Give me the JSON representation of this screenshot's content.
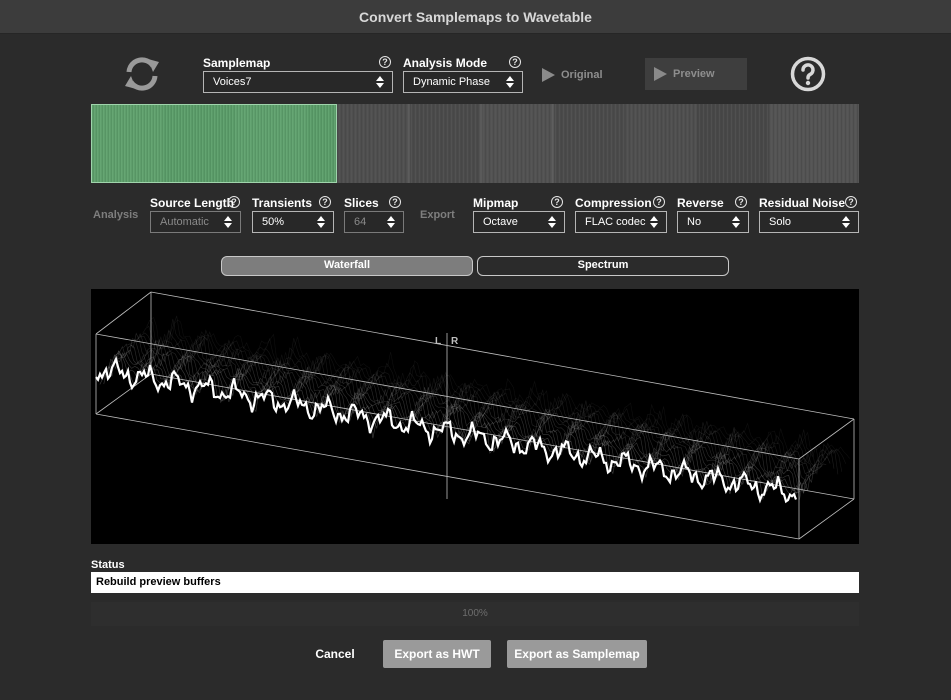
{
  "window": {
    "title": "Convert Samplemaps to Wavetable"
  },
  "toolbar": {
    "refresh_icon": "refresh-icon",
    "samplemap": {
      "label": "Samplemap",
      "value": "Voices7"
    },
    "analysis_mode": {
      "label": "Analysis Mode",
      "value": "Dynamic Phase"
    },
    "original_label": "Original",
    "preview_label": "Preview",
    "help_icon": "help-icon"
  },
  "parameters": {
    "analysis_label": "Analysis",
    "export_label": "Export",
    "source_length": {
      "label": "Source Length",
      "value": "Automatic"
    },
    "transients": {
      "label": "Transients",
      "value": "50%"
    },
    "slices": {
      "label": "Slices",
      "value": "64"
    },
    "mipmap": {
      "label": "Mipmap",
      "value": "Octave"
    },
    "compression": {
      "label": "Compression",
      "value": "FLAC codec"
    },
    "reverse": {
      "label": "Reverse",
      "value": "No"
    },
    "residual_noise": {
      "label": "Residual Noise",
      "value": "Solo"
    }
  },
  "view_tabs": {
    "waterfall": "Waterfall",
    "spectrum": "Spectrum",
    "selected": "Waterfall"
  },
  "waterfall": {
    "left_label": "L",
    "right_label": "R"
  },
  "status": {
    "label": "Status",
    "message": "Rebuild preview buffers",
    "progress_text": "100%",
    "progress": 1.0
  },
  "footer": {
    "cancel": "Cancel",
    "export_hwt": "Export as HWT",
    "export_samplemap": "Export as Samplemap"
  },
  "colors": {
    "selection_green": "#5a9a68",
    "background": "#2b2b2b",
    "titlebar": "#3c3c3c"
  }
}
